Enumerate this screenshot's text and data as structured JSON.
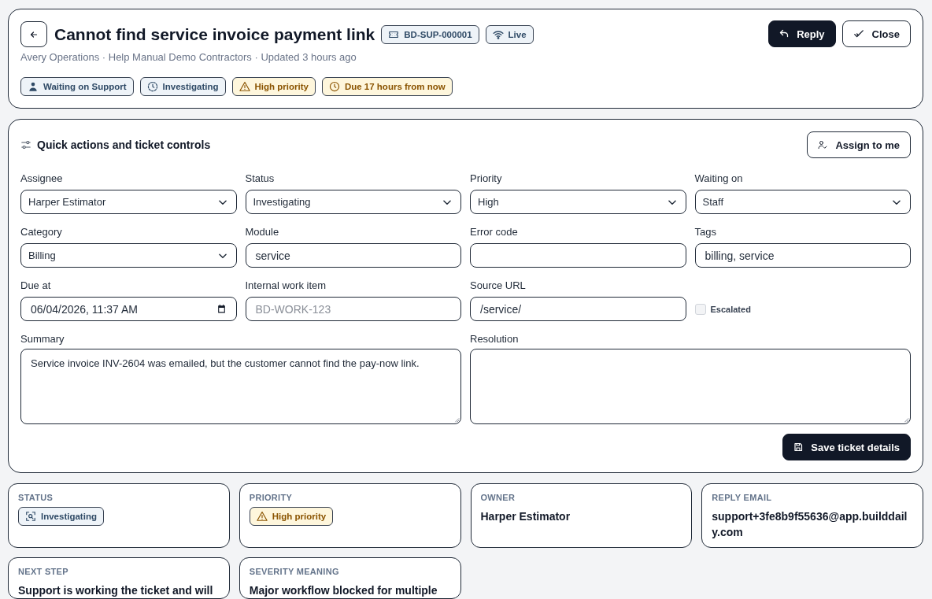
{
  "header": {
    "title": "Cannot find service invoice payment link",
    "ticket_id": "BD-SUP-000001",
    "live_label": "Live",
    "subtitle": "Avery Operations · Help Manual Demo Contractors · Updated 3 hours ago",
    "chips": [
      {
        "label": "Waiting on Support",
        "kind": "waiting"
      },
      {
        "label": "Investigating",
        "kind": "status"
      },
      {
        "label": "High priority",
        "kind": "priority"
      },
      {
        "label": "Due 17 hours from now",
        "kind": "due"
      }
    ],
    "actions": [
      {
        "label": "Reply",
        "kind": "reply"
      },
      {
        "label": "Close",
        "kind": "close"
      }
    ]
  },
  "controls": {
    "title": "Quick actions and ticket controls",
    "assign_button": "Assign to me",
    "fields": [
      {
        "label": "Assignee",
        "kind": "select",
        "value": "Harper Estimator"
      },
      {
        "label": "Status",
        "kind": "select",
        "value": "Investigating"
      },
      {
        "label": "Priority",
        "kind": "select",
        "value": "High"
      },
      {
        "label": "Waiting on",
        "kind": "select",
        "value": "Staff"
      },
      {
        "label": "Category",
        "kind": "select",
        "value": "Billing"
      },
      {
        "label": "Module",
        "kind": "text",
        "value": "service"
      },
      {
        "label": "Error code",
        "kind": "text"
      },
      {
        "label": "Tags",
        "kind": "text",
        "value": "billing, service"
      },
      {
        "label": "Due at",
        "kind": "datetime",
        "value": "06/04/2026, 11:37 AM"
      },
      {
        "label": "Internal work item",
        "kind": "text",
        "placeholder": "BD-WORK-123"
      },
      {
        "label": "Source URL",
        "kind": "text",
        "value": "/service/"
      },
      {
        "label": "Escalated",
        "kind": "checkbox",
        "checked": false
      },
      {
        "label": "Summary",
        "kind": "textarea",
        "value": "Service invoice INV-2604 was emailed, but the customer cannot find the pay-now link."
      },
      {
        "label": "Resolution",
        "kind": "textarea"
      }
    ],
    "save_button": "Save ticket details"
  },
  "summary_cards": [
    {
      "label": "STATUS",
      "kind": "status",
      "value": "Investigating"
    },
    {
      "label": "PRIORITY",
      "kind": "priority",
      "value": "High priority"
    },
    {
      "label": "OWNER",
      "kind": "text",
      "value": "Harper Estimator"
    },
    {
      "label": "REPLY EMAIL",
      "kind": "text",
      "value": "support+3fe8b9f55636@app.builddaily.com"
    },
    {
      "label": "NEXT STEP",
      "kind": "text",
      "value": "Support is working the ticket and will"
    },
    {
      "label": "SEVERITY MEANING",
      "kind": "text",
      "value": "Major workflow blocked for multiple"
    }
  ]
}
